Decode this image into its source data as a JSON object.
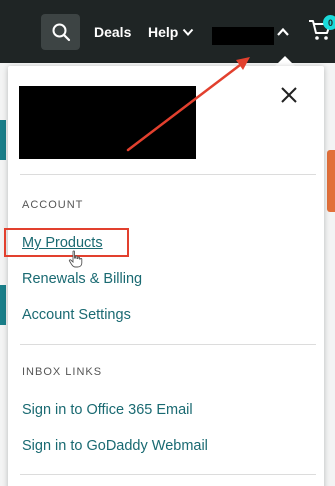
{
  "header": {
    "deals_label": "Deals",
    "help_label": "Help",
    "cart_count": "0",
    "icons": [
      "search-icon",
      "chevron-down-icon",
      "chevron-up-icon",
      "cart-icon"
    ]
  },
  "dropdown": {
    "close_icon": "close-icon",
    "account_section": {
      "heading": "ACCOUNT",
      "items": [
        {
          "label": "My Products"
        },
        {
          "label": "Renewals & Billing"
        },
        {
          "label": "Account Settings"
        }
      ]
    },
    "inbox_section": {
      "heading": "INBOX LINKS",
      "items": [
        {
          "label": "Sign in to Office 365 Email"
        },
        {
          "label": "Sign in to GoDaddy Webmail"
        }
      ]
    }
  },
  "colors": {
    "topbar_bg": "#1f2525",
    "link": "#1a6a72",
    "annotation": "#e2402e",
    "cart_badge": "#1bdbdb"
  }
}
